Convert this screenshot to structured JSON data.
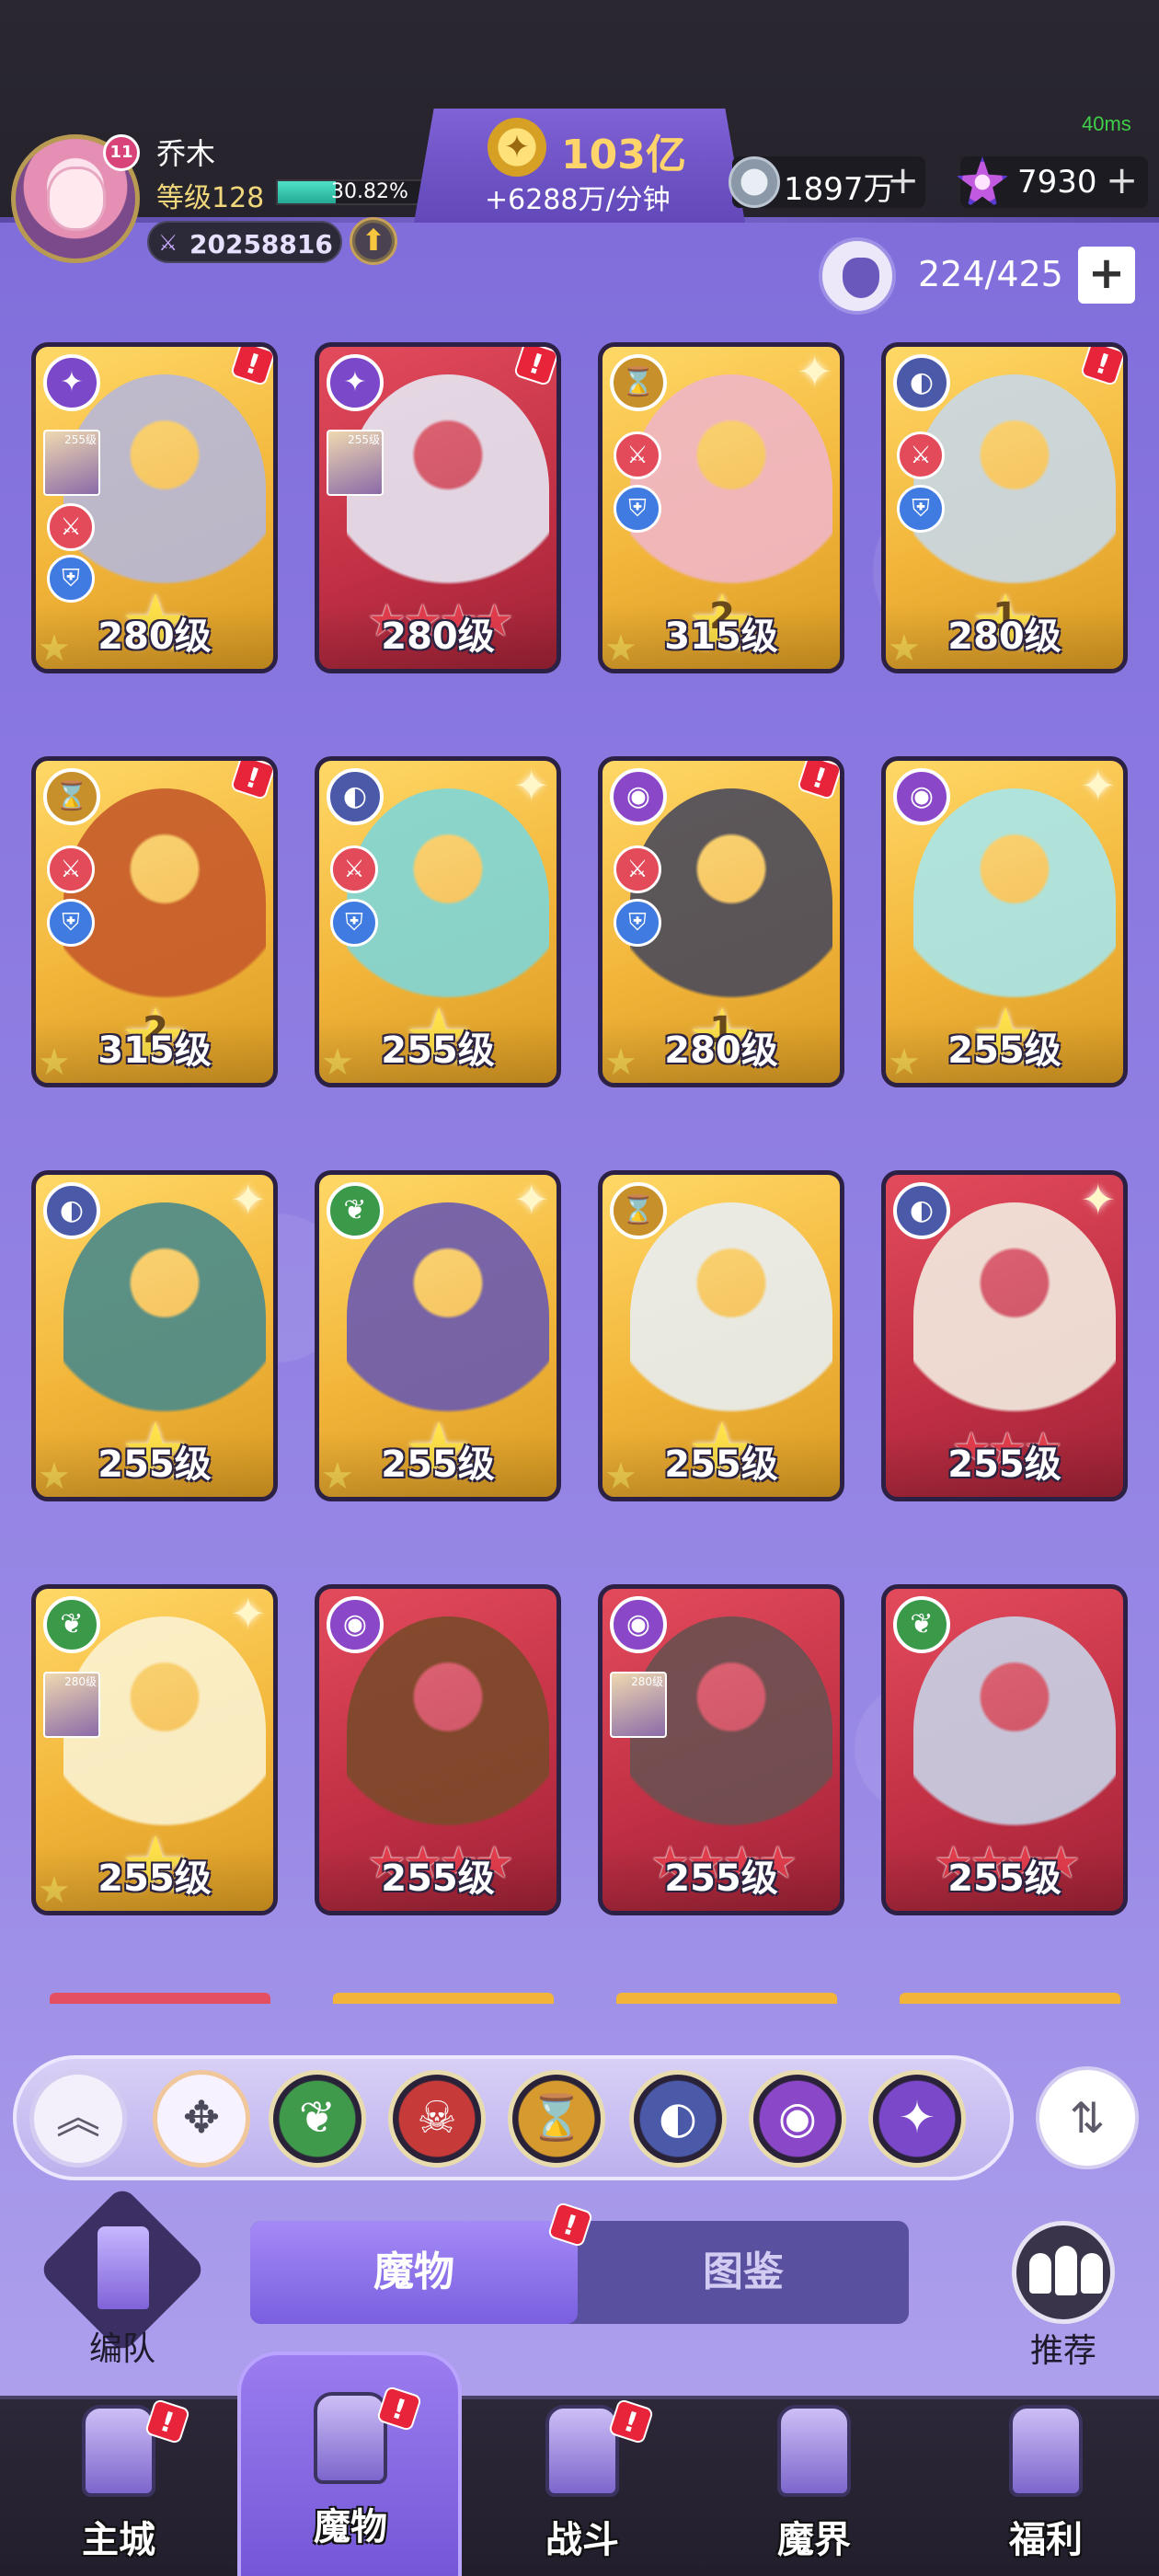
{
  "status": {
    "ping": "40ms"
  },
  "player": {
    "name": "乔木",
    "level": "等级128",
    "exp_percent": "30.82%",
    "exp_fraction": 0.3082,
    "power": "20258816",
    "avatar_badge": "11"
  },
  "currency": {
    "gold": "103亿",
    "gold_rate": "+6288万/分钟",
    "silver": "1897万",
    "gems": "7930",
    "plus": "+"
  },
  "roster": {
    "count": "224/425",
    "plus": "+"
  },
  "cards": [
    {
      "level": "280级",
      "frame": "gold",
      "faction": "✦",
      "faction_color": "#7a48c8",
      "star": "★",
      "star_num": "",
      "alert": true,
      "mini": "255级",
      "weapons": true
    },
    {
      "level": "280级",
      "frame": "red",
      "faction": "✦",
      "faction_color": "#7a48c8",
      "stars": "★★★★",
      "alert": true,
      "mini": "255级",
      "weapons": false
    },
    {
      "level": "315级",
      "frame": "gold",
      "faction": "⌛",
      "faction_color": "#c8902a",
      "star": "★",
      "star_num": "2",
      "spark": true,
      "weapons": true
    },
    {
      "level": "280级",
      "frame": "gold",
      "faction": "◐",
      "faction_color": "#4a5aa8",
      "star": "★",
      "star_num": "1",
      "alert": true,
      "weapons": true
    },
    {
      "level": "315级",
      "frame": "gold",
      "faction": "⌛",
      "faction_color": "#c8902a",
      "star": "★",
      "star_num": "2",
      "alert": true,
      "weapons": true
    },
    {
      "level": "255级",
      "frame": "gold",
      "faction": "◐",
      "faction_color": "#4a5aa8",
      "star": "★",
      "star_num": "",
      "spark": true,
      "weapons": true
    },
    {
      "level": "280级",
      "frame": "gold",
      "faction": "◉",
      "faction_color": "#8a48c8",
      "star": "★",
      "star_num": "1",
      "alert": true,
      "weapons": true
    },
    {
      "level": "255级",
      "frame": "gold",
      "faction": "◉",
      "faction_color": "#8a48c8",
      "star": "★",
      "star_num": "",
      "spark": true,
      "weapons": false
    },
    {
      "level": "255级",
      "frame": "gold",
      "faction": "◐",
      "faction_color": "#4a5aa8",
      "star": "★",
      "star_num": "",
      "spark": true,
      "weapons": false
    },
    {
      "level": "255级",
      "frame": "gold",
      "faction": "❦",
      "faction_color": "#3a9a4a",
      "star": "★",
      "star_num": "",
      "spark": true,
      "weapons": false
    },
    {
      "level": "255级",
      "frame": "gold",
      "faction": "⌛",
      "faction_color": "#c8902a",
      "star": "★",
      "star_num": "",
      "weapons": false
    },
    {
      "level": "255级",
      "frame": "red",
      "faction": "◐",
      "faction_color": "#4a5aa8",
      "stars": "★★★",
      "spark": true,
      "weapons": false
    },
    {
      "level": "255级",
      "frame": "gold",
      "faction": "❦",
      "faction_color": "#3a9a4a",
      "star": "★",
      "star_num": "",
      "spark": true,
      "mini": "280级",
      "weapons": false
    },
    {
      "level": "255级",
      "frame": "red",
      "faction": "◉",
      "faction_color": "#8a48c8",
      "stars": "★★★★",
      "weapons": false
    },
    {
      "level": "255级",
      "frame": "red",
      "faction": "◉",
      "faction_color": "#8a48c8",
      "stars": "★★★★",
      "mini": "280级",
      "weapons": false
    },
    {
      "level": "255级",
      "frame": "red",
      "faction": "❦",
      "faction_color": "#3a9a4a",
      "stars": "★★★★",
      "weapons": false
    }
  ],
  "filters": [
    {
      "icon": "︽",
      "name": "collapse",
      "color": "#ffffff"
    },
    {
      "icon": "✥",
      "name": "all",
      "color": "#ffffff"
    },
    {
      "icon": "❦",
      "name": "nature",
      "color": "#3f9a4c"
    },
    {
      "icon": "☠",
      "name": "demon",
      "color": "#c63a3a"
    },
    {
      "icon": "⌛",
      "name": "time",
      "color": "#d69a2e"
    },
    {
      "icon": "◐",
      "name": "beast",
      "color": "#4a5aa8"
    },
    {
      "icon": "◉",
      "name": "eye",
      "color": "#8a48c8"
    },
    {
      "icon": "✦",
      "name": "arcane",
      "color": "#7a48c8"
    }
  ],
  "sort_icon": "⇅",
  "team": {
    "label": "编队"
  },
  "tabs": {
    "monsters": "魔物",
    "codex": "图鉴",
    "alert": "!"
  },
  "recommend": {
    "label": "推荐"
  },
  "nav": [
    {
      "label": "主城",
      "alert": true
    },
    {
      "label": "魔物",
      "alert": true,
      "active": true
    },
    {
      "label": "战斗",
      "alert": true
    },
    {
      "label": "魔界",
      "alert": false
    },
    {
      "label": "福利",
      "alert": false
    }
  ],
  "alert_mark": "!"
}
